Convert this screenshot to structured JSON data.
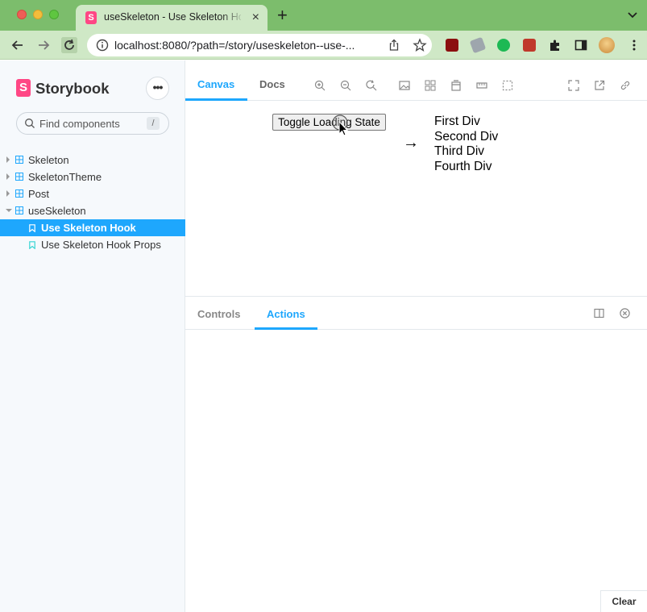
{
  "browser": {
    "tab_title": "useSkeleton - Use Skeleton Hook",
    "tab_favicon": "S",
    "url": "localhost:8080/?path=/story/useskeleton--use-..."
  },
  "sidebar": {
    "brand": "Storybook",
    "logo_letter": "S",
    "menu_label": "•••",
    "search_placeholder": "Find components",
    "search_shortcut": "/",
    "tree": [
      {
        "label": "Skeleton"
      },
      {
        "label": "SkeletonTheme"
      },
      {
        "label": "Post"
      },
      {
        "label": "useSkeleton"
      },
      {
        "label": "Use Skeleton Hook"
      },
      {
        "label": "Use Skeleton Hook Props"
      }
    ]
  },
  "toolbar": {
    "tabs": [
      "Canvas",
      "Docs"
    ]
  },
  "canvas": {
    "button_label": "Toggle Loading State",
    "arrow": "→",
    "divs": [
      "First Div",
      "Second Div",
      "Third Div",
      "Fourth Div"
    ]
  },
  "addons": {
    "tabs": [
      "Controls",
      "Actions"
    ],
    "clear_label": "Clear"
  },
  "colors": {
    "accent": "#1ea7fd",
    "brand": "#ff4785",
    "chrome_green": "#7cbd6c"
  }
}
